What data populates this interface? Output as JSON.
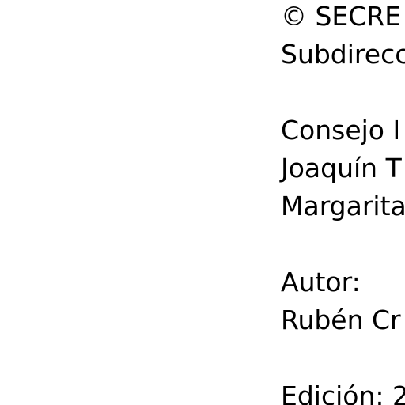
{
  "document": {
    "lines": [
      "© SECRE",
      "Subdirecc",
      "",
      "Consejo I",
      "Joaquín T",
      "Margarita",
      "",
      "Autor:",
      "Rubén Cr",
      "",
      "Edición: 2"
    ]
  }
}
